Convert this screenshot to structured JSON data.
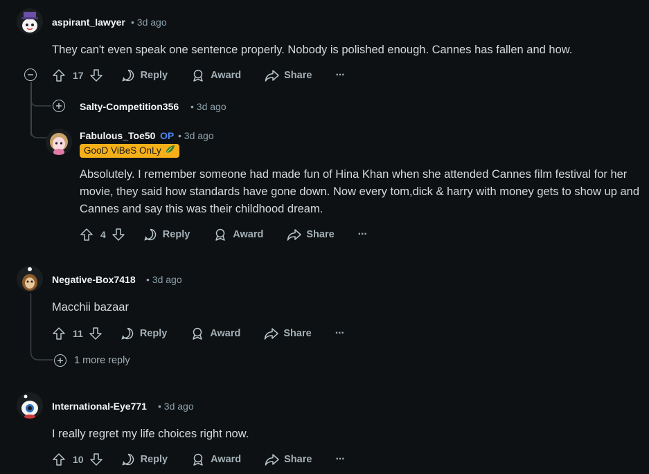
{
  "comments": [
    {
      "username": "aspirant_lawyer",
      "time": "3d ago",
      "body": "They can't even speak one sentence properly. Nobody is polished enough. Cannes has fallen and how.",
      "votes": "17",
      "reply_label": "Reply",
      "award_label": "Award",
      "share_label": "Share",
      "more_label": "···"
    },
    {
      "username": "Salty-Competition356",
      "time": "3d ago"
    },
    {
      "username": "Fabulous_Toe50",
      "op_badge": "OP",
      "time": "3d ago",
      "flair_text": "GooD ViBeS OnLy",
      "flair_emoji": "🌿",
      "body": "Absolutely. I remember someone had made fun of Hina Khan when she attended Cannes film festival for her movie, they said how standards have gone down. Now every tom,dick & harry with money gets to show up and Cannes and say this was their childhood dream.",
      "votes": "4",
      "reply_label": "Reply",
      "award_label": "Award",
      "share_label": "Share",
      "more_label": "···"
    },
    {
      "username": "Negative-Box7418",
      "time": "3d ago",
      "body": "Macchii bazaar",
      "votes": "11",
      "reply_label": "Reply",
      "award_label": "Award",
      "share_label": "Share",
      "more_label": "···",
      "more_replies": "1 more reply"
    },
    {
      "username": "International-Eye771",
      "time": "3d ago",
      "body": "I really regret my life choices right now.",
      "votes": "10",
      "reply_label": "Reply",
      "award_label": "Award",
      "share_label": "Share",
      "more_label": "···"
    }
  ],
  "separator": "•",
  "colors": {
    "background": "#0e1113",
    "op_badge": "#4e86f5",
    "flair_bg": "#f5b019",
    "thread_line": "#3a4247"
  },
  "icons": [
    "upvote-icon",
    "downvote-icon",
    "reply-bubble-icon",
    "award-icon",
    "share-icon",
    "more-options-icon",
    "collapse-icon",
    "expand-icon"
  ]
}
